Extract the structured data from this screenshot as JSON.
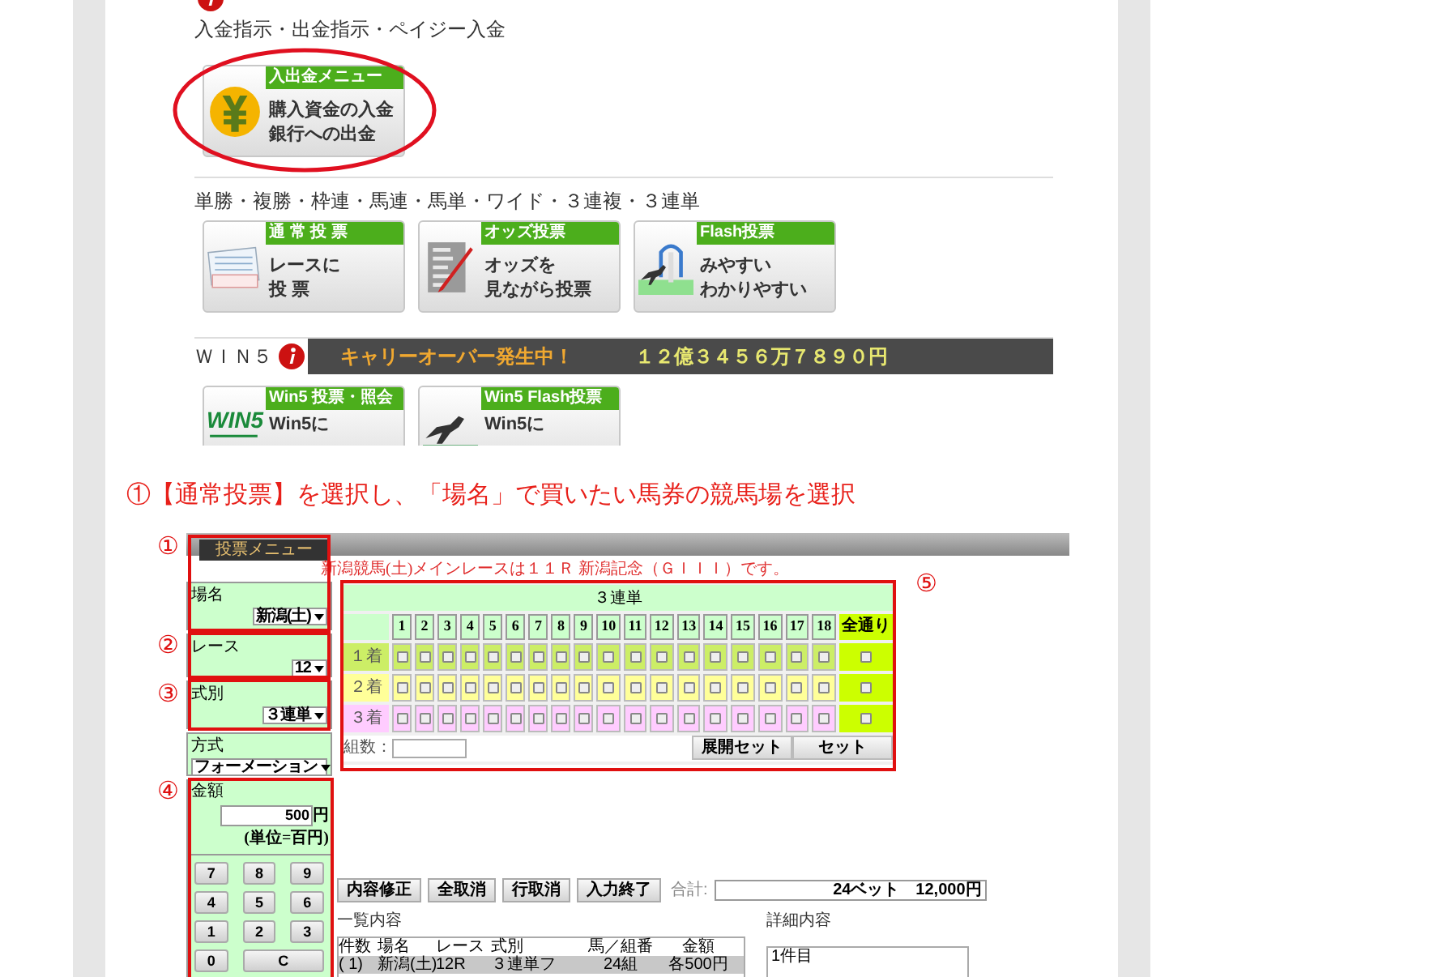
{
  "funds_section": {
    "heading": "入金指示・出金指示・ペイジー入金",
    "banner": {
      "kind": "funds",
      "label": "入出金メニュー",
      "lines": [
        "購入資金の入金",
        "銀行への出金"
      ]
    }
  },
  "betting_section": {
    "heading": "単勝・複勝・枠連・馬連・馬単・ワイド・３連複・３連単",
    "banners": [
      {
        "kind": "normal",
        "label": "通 常 投 票",
        "lines": [
          "レースに",
          "投 票"
        ]
      },
      {
        "kind": "odds",
        "label": "オッズ投票",
        "lines": [
          "オッズを",
          "見ながら投票"
        ]
      },
      {
        "kind": "flash",
        "label": "Flash投票",
        "lines": [
          "みやすい",
          "わかりやすい"
        ]
      }
    ]
  },
  "win5_section": {
    "heading": "ＷＩＮ５",
    "carryover_label": "キャリーオーバー発生中！",
    "carryover_amount": "１２億３４５６万７８９０円",
    "banners": [
      {
        "kind": "win5",
        "label": "Win5 投票・照会",
        "logo": "WIN5",
        "lines": [
          "Win5に"
        ]
      },
      {
        "kind": "win5_flash",
        "label": "Win5 Flash投票",
        "lines": [
          "Win5に"
        ]
      }
    ]
  },
  "instruction": "①【通常投票】を選択し、「場名」で買いたい馬券の競馬場を選択",
  "form": {
    "tab": "投票メニュー",
    "notice": "新潟競馬(土)メインレースは１１Ｒ 新潟記念（ＧＩＩＩ）です。",
    "side_fields": [
      {
        "label": "場名",
        "value": "新潟(土)"
      },
      {
        "label": "レース",
        "value": "12"
      },
      {
        "label": "式別",
        "value": "３連単"
      },
      {
        "label": "方式",
        "value": "フォーメーション"
      }
    ],
    "amount": {
      "label": "金額",
      "value": "500",
      "unit": "円",
      "note": "(単位=百円)"
    },
    "keypad": [
      "7",
      "8",
      "9",
      "4",
      "5",
      "6",
      "1",
      "2",
      "3",
      "0",
      "C"
    ],
    "grid": {
      "title": "３連単",
      "columns": [
        "1",
        "2",
        "3",
        "4",
        "5",
        "6",
        "7",
        "8",
        "9",
        "10",
        "11",
        "12",
        "13",
        "14",
        "15",
        "16",
        "17",
        "18"
      ],
      "all_label": "全通り",
      "rows": [
        {
          "label": "１着",
          "color": "#ccee66",
          "checked": [
            false,
            false,
            false,
            false,
            false,
            false,
            false,
            false,
            false,
            false,
            false,
            false,
            false,
            false,
            false,
            false,
            false,
            false,
            false
          ]
        },
        {
          "label": "２着",
          "color": "#ffff99",
          "checked": [
            false,
            false,
            false,
            false,
            false,
            false,
            false,
            false,
            false,
            false,
            false,
            false,
            false,
            false,
            false,
            false,
            false,
            false,
            false
          ]
        },
        {
          "label": "３着",
          "color": "#ffccff",
          "checked": [
            false,
            false,
            false,
            false,
            false,
            false,
            false,
            false,
            false,
            false,
            false,
            false,
            false,
            false,
            false,
            false,
            false,
            false,
            false
          ]
        }
      ],
      "count_label": "組数：",
      "buttons": [
        "展開セット",
        "セット"
      ]
    },
    "actions": [
      "内容修正",
      "全取消",
      "行取消",
      "入力終了"
    ],
    "total": {
      "label": "合計:",
      "value": "24ベット　12,000円"
    },
    "list": {
      "title": "一覧内容",
      "columns": [
        "件数",
        "場名",
        "レース",
        "式別",
        "馬／組番",
        "金額"
      ],
      "rows": [
        {
          "cells": [
            "( 1)",
            "新潟(土)",
            "12R",
            "３連単フ",
            "24組",
            "各500円"
          ],
          "selected": true
        }
      ]
    },
    "detail": {
      "title": "詳細内容",
      "lines": [
        "1件目"
      ]
    },
    "annotations": [
      {
        "label": "①"
      },
      {
        "label": "②"
      },
      {
        "label": "③"
      },
      {
        "label": "④"
      },
      {
        "label": "⑤"
      }
    ]
  }
}
